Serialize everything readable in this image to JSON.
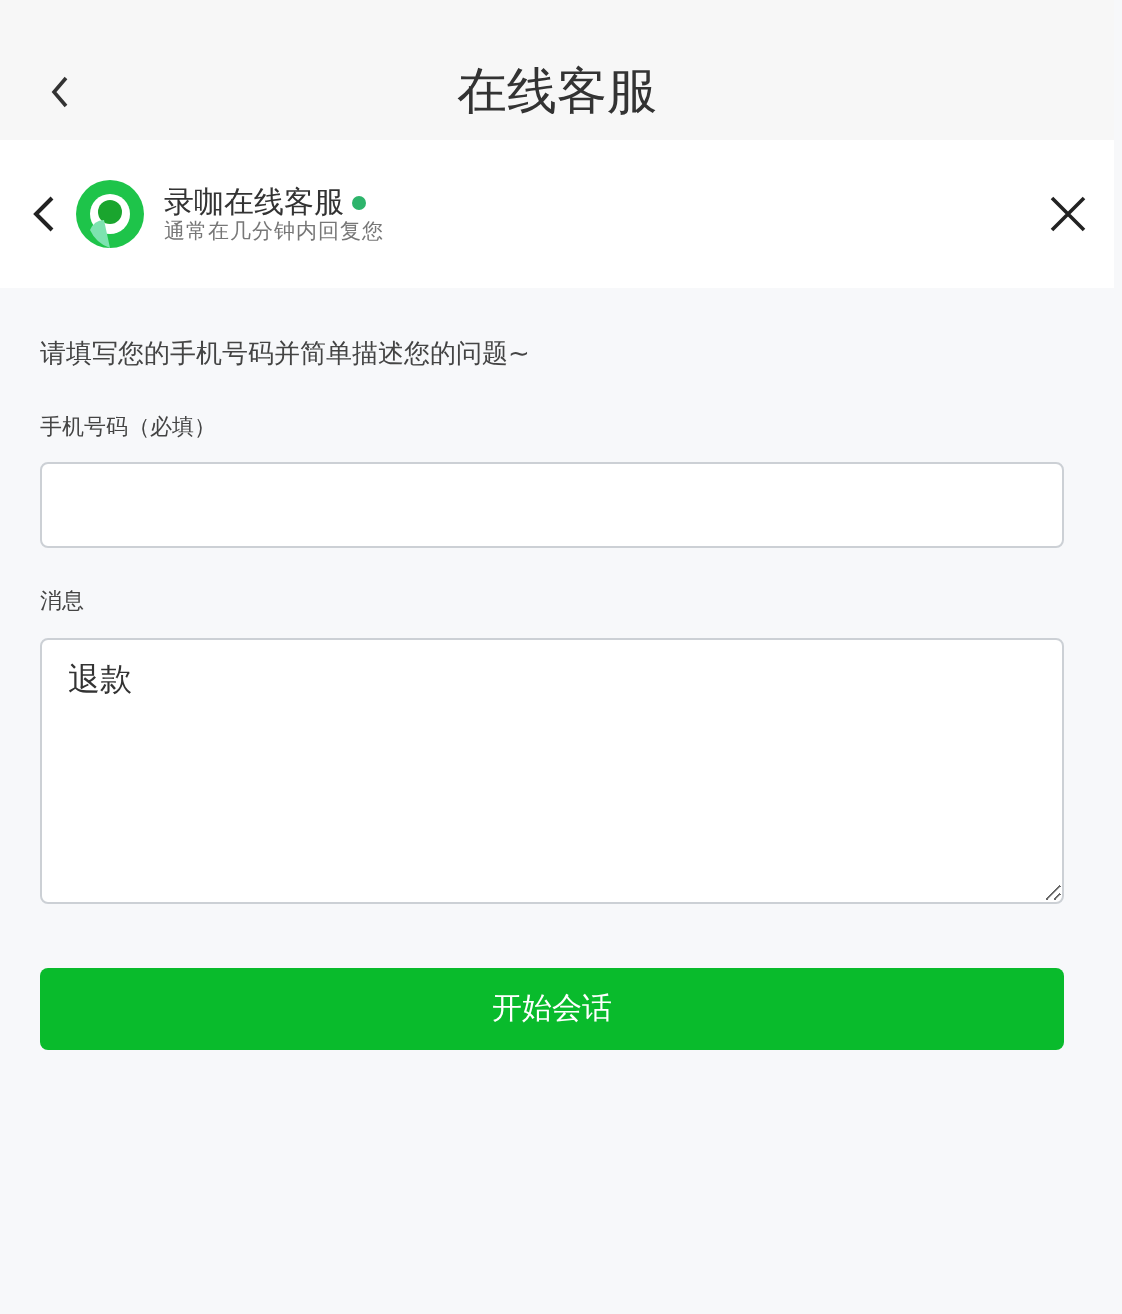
{
  "nav_bar": {
    "title": "在线客服"
  },
  "chat_header": {
    "name": "录咖在线客服",
    "online": true,
    "subtitle": "通常在几分钟内回复您"
  },
  "form": {
    "intro": "请填写您的手机号码并简单描述您的问题~",
    "fields": [
      {
        "label": "手机号码（必填）",
        "kind": "input"
      },
      {
        "label": "消息",
        "kind": "textarea",
        "value": "退款"
      }
    ],
    "submit": "开始会话"
  }
}
